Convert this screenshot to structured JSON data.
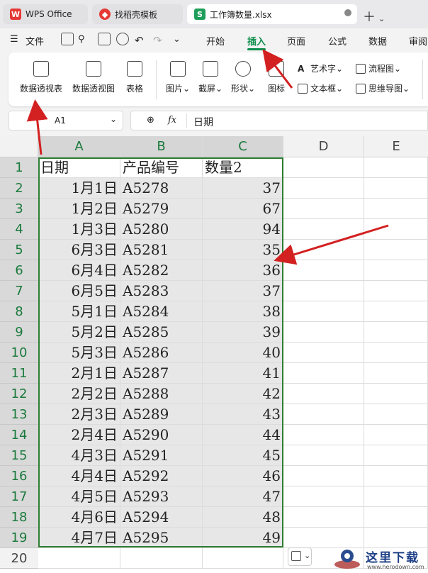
{
  "tabs": [
    {
      "label": "WPS Office",
      "icon": "wps-logo-icon"
    },
    {
      "label": "找稻壳模板",
      "icon": "docer-icon"
    },
    {
      "label": "工作簿数量.xlsx",
      "icon": "spreadsheet-s-icon",
      "icon_text": "S"
    }
  ],
  "menu": {
    "file": "文件",
    "items": [
      "开始",
      "插入",
      "页面",
      "公式",
      "数据",
      "审阅"
    ],
    "active": "插入"
  },
  "ribbon": {
    "pivot_table": "数据透视表",
    "pivot_chart": "数据透视图",
    "table": "表格",
    "picture": "图片",
    "screenshot": "截屏",
    "shape": "形状",
    "icon": "图标",
    "wordart": "艺术字",
    "textbox": "文本框",
    "flowchart": "流程图",
    "mindmap": "思维导图"
  },
  "formula_bar": {
    "name_box": "A1",
    "fx": "fx",
    "content": "日期"
  },
  "columns": [
    "A",
    "B",
    "C",
    "D",
    "E"
  ],
  "rows": [
    {
      "n": "1",
      "date": "日期",
      "code": "产品编号",
      "qty": "数量2"
    },
    {
      "n": "2",
      "date": "1月1日",
      "code": "A5278",
      "qty": "37"
    },
    {
      "n": "3",
      "date": "1月2日",
      "code": "A5279",
      "qty": "67"
    },
    {
      "n": "4",
      "date": "1月3日",
      "code": "A5280",
      "qty": "94"
    },
    {
      "n": "5",
      "date": "6月3日",
      "code": "A5281",
      "qty": "35"
    },
    {
      "n": "6",
      "date": "6月4日",
      "code": "A5282",
      "qty": "36"
    },
    {
      "n": "7",
      "date": "6月5日",
      "code": "A5283",
      "qty": "37"
    },
    {
      "n": "8",
      "date": "5月1日",
      "code": "A5284",
      "qty": "38"
    },
    {
      "n": "9",
      "date": "5月2日",
      "code": "A5285",
      "qty": "39"
    },
    {
      "n": "10",
      "date": "5月3日",
      "code": "A5286",
      "qty": "40"
    },
    {
      "n": "11",
      "date": "2月1日",
      "code": "A5287",
      "qty": "41"
    },
    {
      "n": "12",
      "date": "2月2日",
      "code": "A5288",
      "qty": "42"
    },
    {
      "n": "13",
      "date": "2月3日",
      "code": "A5289",
      "qty": "43"
    },
    {
      "n": "14",
      "date": "2月4日",
      "code": "A5290",
      "qty": "44"
    },
    {
      "n": "15",
      "date": "4月3日",
      "code": "A5291",
      "qty": "45"
    },
    {
      "n": "16",
      "date": "4月4日",
      "code": "A5292",
      "qty": "46"
    },
    {
      "n": "17",
      "date": "4月5日",
      "code": "A5293",
      "qty": "47"
    },
    {
      "n": "18",
      "date": "4月6日",
      "code": "A5294",
      "qty": "48"
    },
    {
      "n": "19",
      "date": "4月7日",
      "code": "A5295",
      "qty": "49"
    },
    {
      "n": "20",
      "date": "",
      "code": "",
      "qty": ""
    }
  ],
  "watermark": {
    "title": "这里下载",
    "url": "www.herodown.com"
  },
  "colors": {
    "accent": "#0b8f4a",
    "selection_border": "#2e7d32",
    "annotation_arrow": "#d32020"
  }
}
